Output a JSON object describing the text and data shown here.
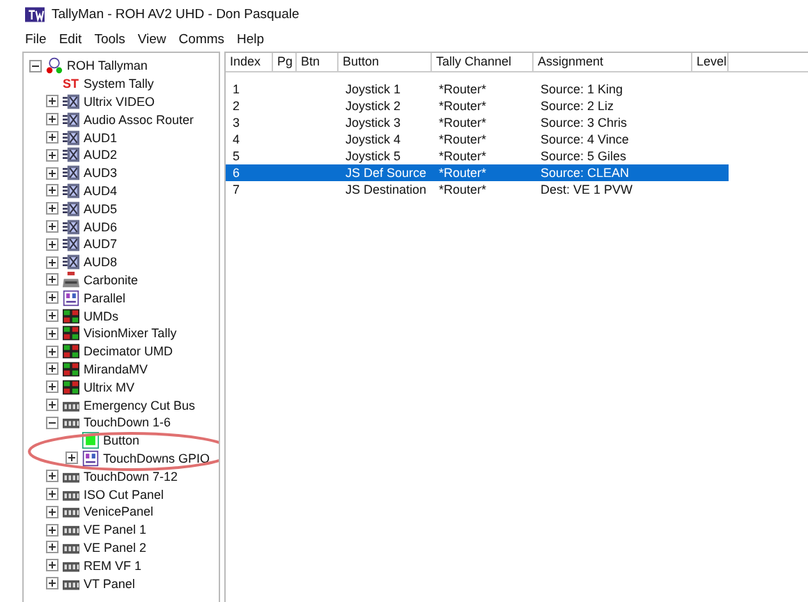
{
  "window": {
    "title": "TallyMan - ROH AV2 UHD - Don Pasquale"
  },
  "menu": [
    "File",
    "Edit",
    "Tools",
    "View",
    "Comms",
    "Help"
  ],
  "tree": [
    {
      "label": "ROH Tallyman",
      "kind": "root",
      "expanded": true,
      "children": [
        {
          "label": "System Tally",
          "kind": "st",
          "glyph": "ST"
        },
        {
          "label": "Ultrix VIDEO",
          "kind": "router",
          "expanded": false
        },
        {
          "label": "Audio Assoc Router",
          "kind": "router",
          "expanded": false
        },
        {
          "label": "AUD1",
          "kind": "router",
          "expanded": false
        },
        {
          "label": "AUD2",
          "kind": "router",
          "expanded": false
        },
        {
          "label": "AUD3",
          "kind": "router",
          "expanded": false
        },
        {
          "label": "AUD4",
          "kind": "router",
          "expanded": false
        },
        {
          "label": "AUD5",
          "kind": "router",
          "expanded": false
        },
        {
          "label": "AUD6",
          "kind": "router",
          "expanded": false
        },
        {
          "label": "AUD7",
          "kind": "router",
          "expanded": false
        },
        {
          "label": "AUD8",
          "kind": "router",
          "expanded": false
        },
        {
          "label": "Carbonite",
          "kind": "mixer",
          "expanded": false
        },
        {
          "label": "Parallel",
          "kind": "gpio",
          "expanded": false
        },
        {
          "label": "UMDs",
          "kind": "umd",
          "expanded": false
        },
        {
          "label": "VisionMixer Tally",
          "kind": "umd",
          "expanded": false
        },
        {
          "label": "Decimator UMD",
          "kind": "umd",
          "expanded": false
        },
        {
          "label": "MirandaMV",
          "kind": "umd",
          "expanded": false
        },
        {
          "label": "Ultrix MV",
          "kind": "umd",
          "expanded": false
        },
        {
          "label": "Emergency Cut Bus",
          "kind": "panel",
          "expanded": false
        },
        {
          "label": "TouchDown 1-6",
          "kind": "panel",
          "expanded": true,
          "children": [
            {
              "label": "Button",
              "kind": "button"
            },
            {
              "label": "TouchDowns GPIO",
              "kind": "gpio",
              "expanded": false
            }
          ]
        },
        {
          "label": "TouchDown 7-12",
          "kind": "panel",
          "expanded": false
        },
        {
          "label": "ISO Cut Panel",
          "kind": "panel",
          "expanded": false
        },
        {
          "label": "VenicePanel",
          "kind": "panel",
          "expanded": false
        },
        {
          "label": "VE Panel 1",
          "kind": "panel",
          "expanded": false
        },
        {
          "label": "VE Panel 2",
          "kind": "panel",
          "expanded": false
        },
        {
          "label": "REM VF 1",
          "kind": "panel",
          "expanded": false
        },
        {
          "label": "VT Panel",
          "kind": "panel",
          "expanded": false
        }
      ]
    }
  ],
  "table": {
    "columns": [
      "Index",
      "Pg",
      "Btn",
      "Button",
      "Tally Channel",
      "Assignment",
      "Level"
    ],
    "rows": [
      {
        "cells": [
          "1",
          "",
          "",
          "Joystick 1",
          "*Router*",
          "Source: 1 King",
          ""
        ],
        "selected": false
      },
      {
        "cells": [
          "2",
          "",
          "",
          "Joystick 2",
          "*Router*",
          "Source: 2 Liz",
          ""
        ],
        "selected": false
      },
      {
        "cells": [
          "3",
          "",
          "",
          "Joystick 3",
          "*Router*",
          "Source: 3 Chris",
          ""
        ],
        "selected": false
      },
      {
        "cells": [
          "4",
          "",
          "",
          "Joystick 4",
          "*Router*",
          "Source: 4 Vince",
          ""
        ],
        "selected": false
      },
      {
        "cells": [
          "5",
          "",
          "",
          "Joystick 5",
          "*Router*",
          "Source: 5 Giles",
          ""
        ],
        "selected": false
      },
      {
        "cells": [
          "6",
          "",
          "",
          "JS Def Source",
          "*Router*",
          "Source: CLEAN",
          ""
        ],
        "selected": true
      },
      {
        "cells": [
          "7",
          "",
          "",
          "JS Destination",
          "*Router*",
          "Dest: VE 1 PVW",
          ""
        ],
        "selected": false
      }
    ]
  }
}
